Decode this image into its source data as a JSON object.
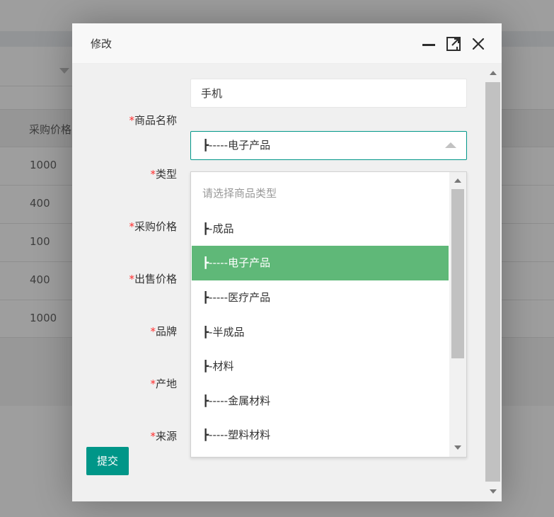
{
  "background": {
    "table_header": "采购价格",
    "rows": [
      "1000",
      "400",
      "100",
      "400",
      "1000"
    ]
  },
  "dialog": {
    "title": "修改",
    "icons": {
      "minimize": "minimize-icon",
      "maximize": "maximize-icon",
      "close": "close-icon"
    },
    "form": {
      "required_mark": "*",
      "product_name": {
        "label": "商品名称",
        "value": "手机"
      },
      "type": {
        "label": "类型",
        "value": "┣-----电子产品"
      },
      "purchase_price": {
        "label": "采购价格"
      },
      "sale_price": {
        "label": "出售价格"
      },
      "brand": {
        "label": "品牌"
      },
      "origin": {
        "label": "产地"
      },
      "source": {
        "label": "来源"
      }
    },
    "submit_label": "提交"
  },
  "dropdown": {
    "placeholder": "请选择商品类型",
    "options": [
      "┣-成品",
      "┣-----电子产品",
      "┣-----医疗产品",
      "┣-半成品",
      "┣-材料",
      "┣-----金属材料",
      "┣-----塑料材料"
    ],
    "selected_index": 1
  },
  "colors": {
    "accent": "#009688",
    "selected_bg": "#5fb878",
    "required": "#ff2d2d"
  }
}
